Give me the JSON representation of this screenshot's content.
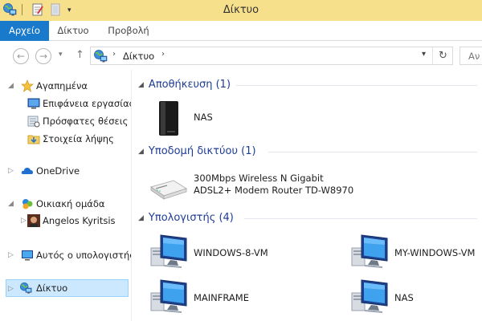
{
  "window": {
    "title": "Δίκτυο"
  },
  "ribbon": {
    "tabs": [
      {
        "label": "Αρχείο"
      },
      {
        "label": "Δίκτυο"
      },
      {
        "label": "Προβολή"
      }
    ]
  },
  "address": {
    "crumb": "Δίκτυο",
    "search_placeholder": "Αν"
  },
  "nav": {
    "favorites": {
      "label": "Αγαπημένα"
    },
    "favorites_items": [
      {
        "label": "Επιφάνεια εργασίας"
      },
      {
        "label": "Πρόσφατες θέσεις"
      },
      {
        "label": "Στοιχεία λήψης"
      }
    ],
    "onedrive": {
      "label": "OneDrive"
    },
    "homegroup": {
      "label": "Οικιακή ομάδα"
    },
    "homegroup_user": {
      "label": "Angelos Kyritsis"
    },
    "computer": {
      "label": "Αυτός ο υπολογιστής"
    },
    "network": {
      "label": "Δίκτυο"
    }
  },
  "groups": {
    "storage": {
      "header": "Αποθήκευση (1)",
      "items": [
        {
          "label": "NAS"
        }
      ]
    },
    "infrastructure": {
      "header": "Υποδομή δικτύου (1)",
      "items": [
        {
          "line1": "300Mbps Wireless N Gigabit",
          "line2": "ADSL2+ Modem Router TD-W8970"
        }
      ]
    },
    "computers": {
      "header": "Υπολογιστής (4)",
      "items": [
        {
          "label": "WINDOWS-8-VM"
        },
        {
          "label": "MY-WINDOWS-VM"
        },
        {
          "label": "MAINFRAME"
        },
        {
          "label": "NAS"
        }
      ]
    }
  },
  "colors": {
    "titlebar": "#f7e08c",
    "file_tab": "#1979ca",
    "group_header": "#1e3c96",
    "selection": "#cce8ff"
  }
}
